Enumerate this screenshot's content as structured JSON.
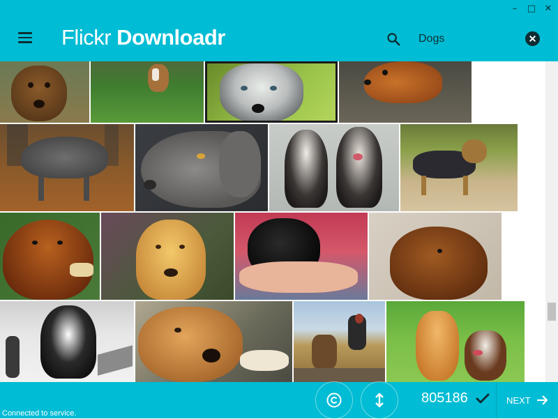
{
  "window": {
    "minimize_glyph": "–",
    "maximize_glyph": "□",
    "close_glyph": "✕"
  },
  "header": {
    "brand_light": "Flickr",
    "brand_bold": "Downloadr",
    "menu_icon": "hamburger-icon",
    "search_icon": "search-icon",
    "search_value": "Dogs",
    "clear_icon": "close-circle-icon",
    "background_color": "#00bcd4"
  },
  "gallery": {
    "photos": [
      {
        "name": "dachshund-close-up",
        "selected": false
      },
      {
        "name": "beagle-running-on-grass",
        "selected": false
      },
      {
        "name": "husky-portrait",
        "selected": true
      },
      {
        "name": "chihuahua-lying-down",
        "selected": false
      },
      {
        "name": "grey-dog-in-autumn-leaves",
        "selected": false
      },
      {
        "name": "weimaraner-profile",
        "selected": false
      },
      {
        "name": "two-tibetan-terriers",
        "selected": false
      },
      {
        "name": "yorkshire-terrier-outdoors",
        "selected": false
      },
      {
        "name": "long-haired-dachshund-with-toy",
        "selected": false
      },
      {
        "name": "yellow-labrador-mix",
        "selected": false
      },
      {
        "name": "black-labrador-puppy-in-hands",
        "selected": false
      },
      {
        "name": "cocker-spaniel-in-sand",
        "selected": false
      },
      {
        "name": "sled-dogs-black-and-white",
        "selected": false
      },
      {
        "name": "golden-retriever-lying",
        "selected": false
      },
      {
        "name": "woman-with-german-shepherd",
        "selected": false
      },
      {
        "name": "two-dogs-on-lawn",
        "selected": false
      }
    ]
  },
  "footer": {
    "status": "Connected to service.",
    "license_icon": "copyright-icon",
    "size_icon": "vertical-resize-icon",
    "selected_count": "805186",
    "check_icon": "check-icon",
    "next_label": "NEXT",
    "next_icon": "arrow-right-icon",
    "background_color": "#00bcd4"
  }
}
